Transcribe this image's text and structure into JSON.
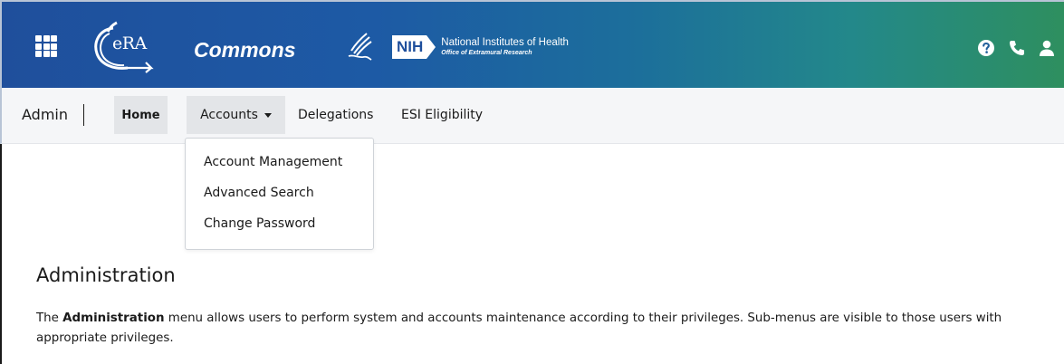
{
  "header": {
    "era_logo_text": "eRA",
    "product_name": "Commons",
    "nih_abbr": "NIH",
    "nih_title": "National Institutes of Health",
    "nih_subtitle": "Office of Extramural Research",
    "icons": [
      "apps-grid-icon",
      "era-logo",
      "hhs-eagle-icon",
      "nih-logo",
      "help-icon",
      "phone-icon",
      "user-icon"
    ],
    "gradient_colors": [
      "#1f4f9c",
      "#23888a",
      "#2e8f5f"
    ]
  },
  "navbar": {
    "brand": "Admin",
    "items": [
      {
        "label": "Home",
        "active": true
      },
      {
        "label": "Accounts",
        "dropdown": true,
        "open": true
      },
      {
        "label": "Delegations"
      },
      {
        "label": "ESI Eligibility"
      }
    ]
  },
  "accounts_menu": {
    "items": [
      {
        "label": "Account Management"
      },
      {
        "label": "Advanced Search"
      },
      {
        "label": "Change Password"
      }
    ]
  },
  "content": {
    "title": "Administration",
    "description_prefix": "The ",
    "description_bold": "Administration",
    "description_rest": " menu allows users to perform system and accounts maintenance according to their privileges. Sub-menus are visible to those users with appropriate privileges."
  }
}
